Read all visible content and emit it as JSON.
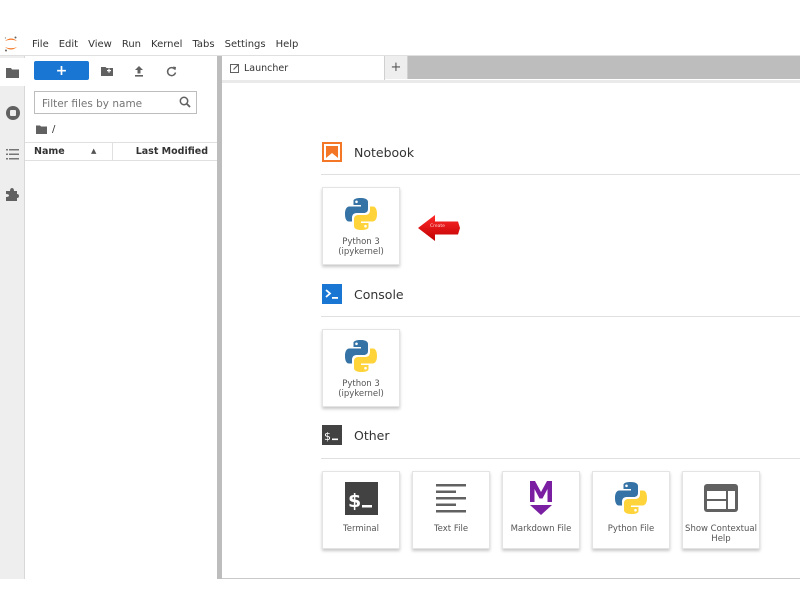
{
  "menubar": {
    "items": [
      "File",
      "Edit",
      "View",
      "Run",
      "Kernel",
      "Tabs",
      "Settings",
      "Help"
    ]
  },
  "activity_bar": {
    "items": [
      {
        "name": "file-browser",
        "icon": "folder-icon",
        "active": true
      },
      {
        "name": "running-kernels",
        "icon": "stop-circle-icon",
        "active": false
      },
      {
        "name": "table-of-contents",
        "icon": "list-icon",
        "active": false
      },
      {
        "name": "extension-manager",
        "icon": "puzzle-icon",
        "active": false
      }
    ]
  },
  "filebrowser": {
    "new_label": "+",
    "filter_placeholder": "Filter files by name",
    "breadcrumb": "/",
    "columns": {
      "name": "Name",
      "modified": "Last Modified"
    },
    "files": []
  },
  "tabs": [
    {
      "label": "Launcher",
      "icon": "launcher-icon",
      "active": true
    }
  ],
  "tab_add_label": "+",
  "launcher": {
    "sections": [
      {
        "title": "Notebook",
        "icon": "notebook-icon",
        "accent": "#f37726",
        "items": [
          {
            "label_line1": "Python 3",
            "label_line2": "(ipykernel)",
            "icon": "python-icon"
          }
        ]
      },
      {
        "title": "Console",
        "icon": "console-icon",
        "accent": "#1976d2",
        "items": [
          {
            "label_line1": "Python 3",
            "label_line2": "(ipykernel)",
            "icon": "python-icon"
          }
        ]
      },
      {
        "title": "Other",
        "icon": "terminal-icon",
        "accent": "#424242",
        "items": [
          {
            "label_line1": "Terminal",
            "label_line2": "",
            "icon": "terminal-icon"
          },
          {
            "label_line1": "Text File",
            "label_line2": "",
            "icon": "text-file-icon"
          },
          {
            "label_line1": "Markdown File",
            "label_line2": "",
            "icon": "markdown-icon"
          },
          {
            "label_line1": "Python File",
            "label_line2": "",
            "icon": "python-icon"
          },
          {
            "label_line1": "Show Contextual",
            "label_line2": "Help",
            "icon": "contextual-help-icon"
          }
        ]
      }
    ]
  },
  "annotation": {
    "arrow_text": "Create",
    "color": "#e00000"
  },
  "colors": {
    "brand_blue": "#1976d2",
    "jupyter_orange": "#f37726",
    "markdown_purple": "#7b1fa2",
    "python_blue": "#3572a5",
    "python_yellow": "#ffd43b"
  }
}
